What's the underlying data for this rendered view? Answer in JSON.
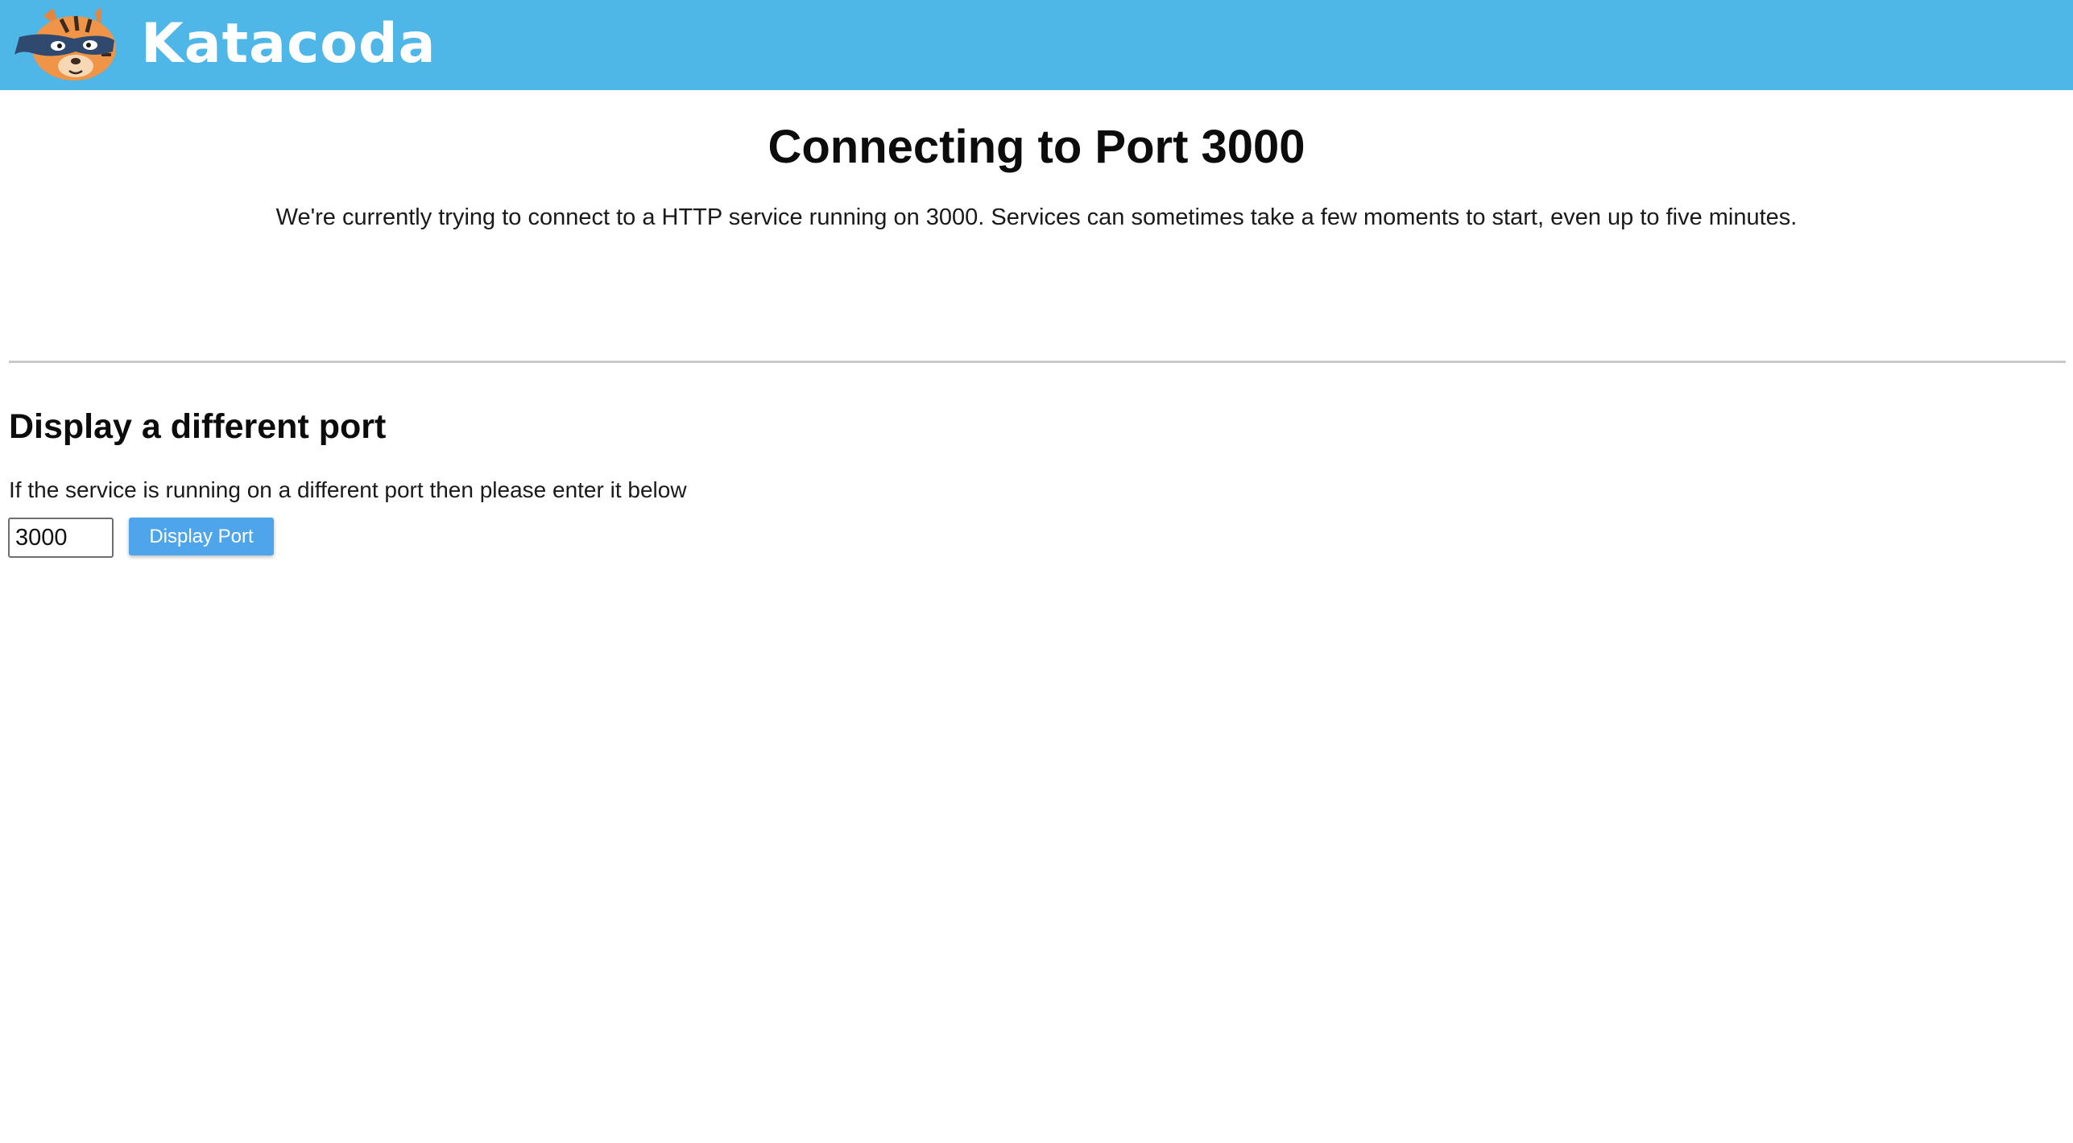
{
  "header": {
    "brand": "Katacoda",
    "logo_icon": "katacoda-cat-logo-icon",
    "background_color": "#4fb6e8"
  },
  "main": {
    "title": "Connecting to Port 3000",
    "description": "We're currently trying to connect to a HTTP service running on 3000. Services can sometimes take a few moments to start, even up to five minutes."
  },
  "port_section": {
    "title": "Display a different port",
    "description": "If the service is running on a different port then please enter it below",
    "port_value": "3000",
    "button_label": "Display Port",
    "button_color": "#4fa5ea"
  }
}
